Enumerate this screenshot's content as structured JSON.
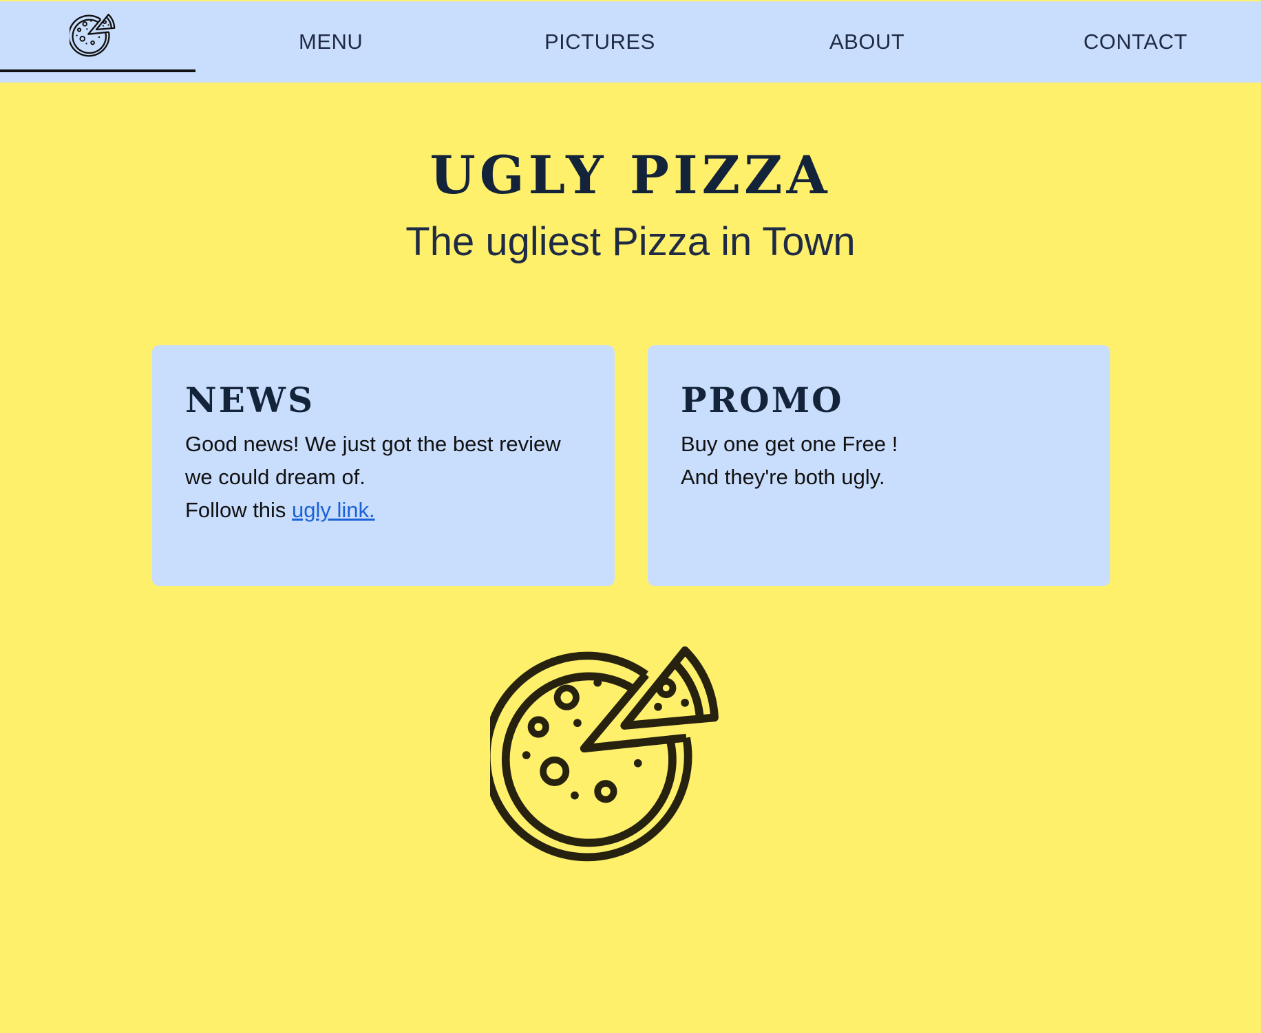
{
  "nav": {
    "logo_icon": "pizza-icon",
    "items": [
      "MENU",
      "PICTURES",
      "ABOUT",
      "CONTACT"
    ]
  },
  "hero": {
    "title": "UGLY PIZZA",
    "subtitle": "The ugliest Pizza in Town"
  },
  "news": {
    "title": "NEWS",
    "line1": "Good news! We just got the best review",
    "line2": "we could dream of.",
    "line3_prefix": "Follow this ",
    "link_text": "ugly link."
  },
  "promo": {
    "title": "PROMO",
    "line1": "Buy one get one Free !",
    "line2": "And they're both ugly."
  },
  "illustration": {
    "icon": "pizza-icon"
  },
  "colors": {
    "page_background": "#fff06b",
    "nav_background": "#c9ddfc",
    "card_background": "#c9ddfc",
    "heading": "#13233a",
    "link": "#1a62d6"
  }
}
